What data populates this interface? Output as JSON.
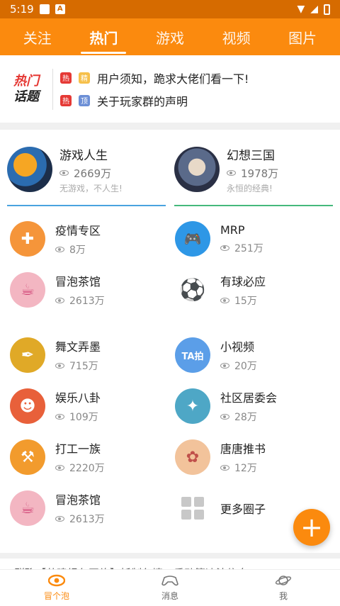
{
  "status_bar": {
    "time": "5:19",
    "notif_a": "A"
  },
  "tabs": [
    {
      "label": "关注"
    },
    {
      "label": "热门"
    },
    {
      "label": "游戏"
    },
    {
      "label": "视频"
    },
    {
      "label": "图片"
    }
  ],
  "hot_topics": {
    "logo_line1": "热门",
    "logo_line2": "话题",
    "items": [
      {
        "tag1": "热",
        "tag2": "精",
        "text": "用户须知，跪求大佬们看一下!"
      },
      {
        "tag1": "热",
        "tag2": "顶",
        "text": "关于玩家群的声明"
      }
    ]
  },
  "featured": [
    {
      "title": "游戏人生",
      "count": "2669万",
      "sub": "无游戏，不人生!",
      "accent": "#4aa3df"
    },
    {
      "title": "幻想三国",
      "count": "1978万",
      "sub": "永恒的经典!",
      "accent": "#45b97c"
    }
  ],
  "circles": [
    {
      "title": "疫情专区",
      "count": "8万",
      "color": "#f5953a",
      "glyph": "✚"
    },
    {
      "title": "MRP",
      "count": "251万",
      "color": "#2e97e6",
      "glyph": "🎮"
    },
    {
      "title": "冒泡茶馆",
      "count": "2613万",
      "color": "#f3b6c2",
      "glyph": "☕"
    },
    {
      "title": "有球必应",
      "count": "15万",
      "color": "#ffffff",
      "glyph": "⚽"
    },
    {
      "title": "舞文弄墨",
      "count": "715万",
      "color": "#e0a927",
      "glyph": "✒"
    },
    {
      "title": "小视频",
      "count": "20万",
      "color": "#5b9ee8",
      "glyph": "TA拍"
    },
    {
      "title": "娱乐八卦",
      "count": "109万",
      "color": "#e8603a",
      "glyph": "☻"
    },
    {
      "title": "社区居委会",
      "count": "28万",
      "color": "#4ea7c6",
      "glyph": "✦"
    },
    {
      "title": "打工一族",
      "count": "2220万",
      "color": "#f29b2d",
      "glyph": "⚒"
    },
    {
      "title": "唐唐推书",
      "count": "12万",
      "color": "#f2c39b",
      "glyph": "✿"
    },
    {
      "title": "冒泡茶馆",
      "count": "2613万",
      "color": "#f3b6c2",
      "glyph": "☕"
    }
  ],
  "more_circles": "更多圈子",
  "fab_label": "+",
  "news_text": "群聊【共建绿色网络】抵制色情，反动等违法信息",
  "bottom_nav": [
    {
      "label": "冒个泡"
    },
    {
      "label": "消息"
    },
    {
      "label": "我"
    }
  ],
  "colors": {
    "brand": "#fb8a0e",
    "status_bar": "#d66b00"
  }
}
